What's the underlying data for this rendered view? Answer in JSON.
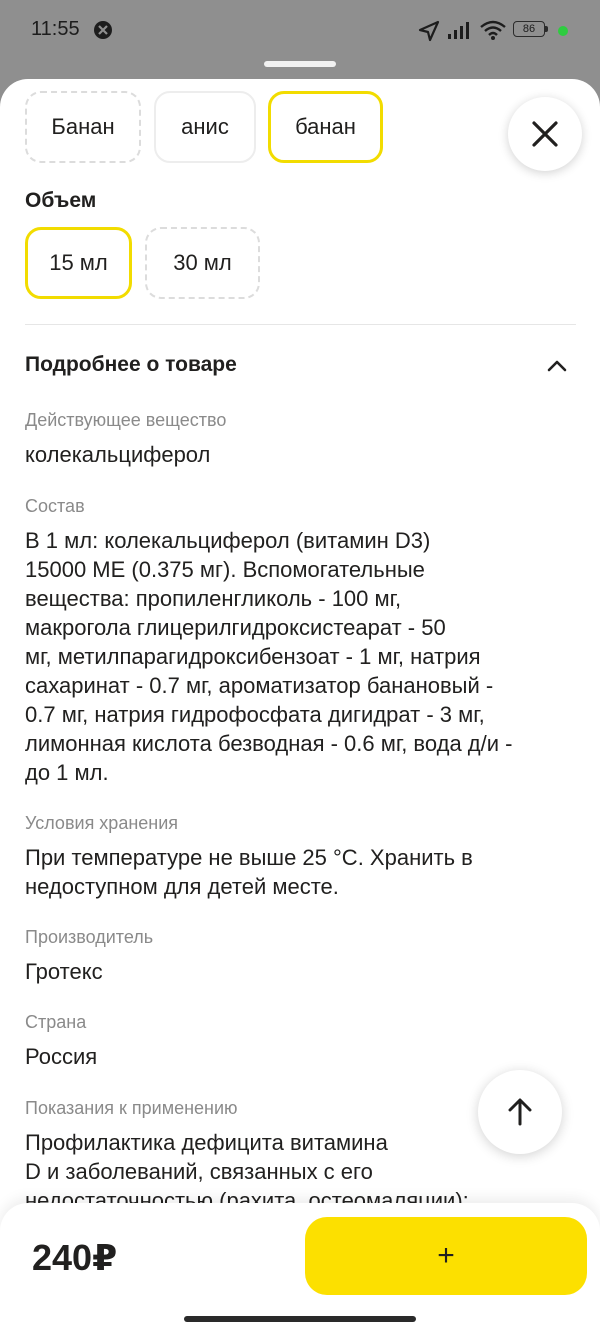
{
  "status_bar": {
    "time": "11:55",
    "battery": "86"
  },
  "flavors": [
    "Банан",
    "анис",
    "банан"
  ],
  "volume": {
    "title": "Объем",
    "options": [
      "15 мл",
      "30 мл"
    ]
  },
  "details": {
    "title": "Подробнее о товаре",
    "active_substance": {
      "label": "Действующее вещество",
      "value": "колекальциферол"
    },
    "composition": {
      "label": "Состав",
      "lines": [
        "В 1 мл: колекальциферол (витамин D3)",
        "15000 МЕ (0.375 мг). Вспомогательные",
        "вещества: пропиленгликоль - 100 мг,",
        "макрогола глицерилгидроксистеарат - 50",
        "мг, метилпарагидроксибензоат - 1 мг, натрия",
        "сахаринат - 0.7 мг, ароматизатор банановый -",
        "0.7 мг, натрия гидрофосфата дигидрат - 3 мг,",
        "лимонная кислота безводная - 0.6 мг, вода д/и -",
        "до 1 мл."
      ]
    },
    "storage": {
      "label": "Условия хранения",
      "lines": [
        "При температуре не выше 25 °С. Хранить в",
        "недоступном для детей месте."
      ]
    },
    "manufacturer": {
      "label": "Производитель",
      "value": "Гротекс"
    },
    "country": {
      "label": "Страна",
      "value": "Россия"
    },
    "indications": {
      "label": "Показания к применению",
      "lines": [
        "Профилактика дефицита витамина",
        "D и заболеваний, связанных с его",
        "недостаточностью (рахита, остеомаляции);"
      ]
    }
  },
  "footer": {
    "price": "240₽",
    "add_label": "+"
  },
  "colors": {
    "accent": "#fce000",
    "selected_border": "#f2dc00",
    "muted_text": "#8a8a8a"
  }
}
